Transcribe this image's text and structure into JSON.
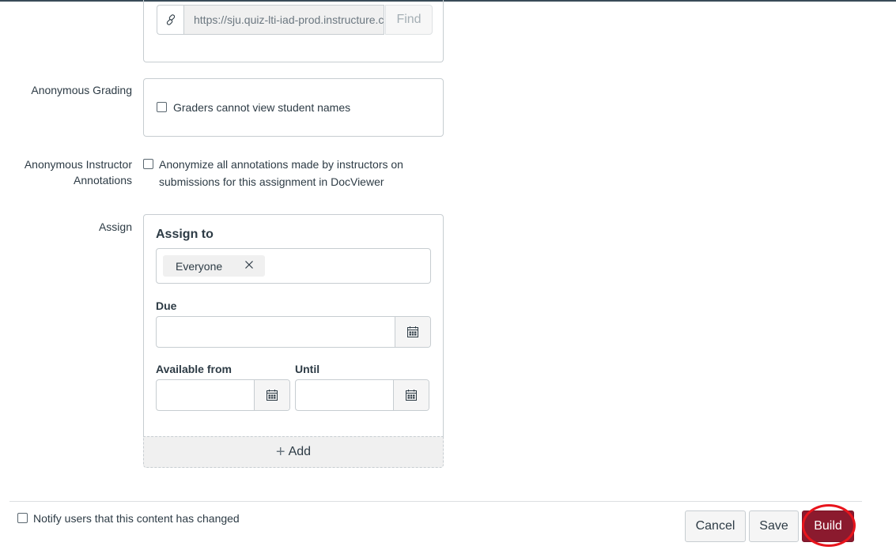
{
  "external_tool": {
    "url_value": "https://sju.quiz-lti-iad-prod.instructure.com",
    "find_label": "Find",
    "icon": "link-icon"
  },
  "anonymous_grading": {
    "label": "Anonymous Grading",
    "checkbox_label": "Graders cannot view student names",
    "checked": false
  },
  "anonymous_annotations": {
    "label_line1": "Anonymous Instructor",
    "label_line2": "Annotations",
    "checkbox_line1": "Anonymize all annotations made by instructors on",
    "checkbox_line2": "submissions for this assignment in DocViewer",
    "checked": false
  },
  "assign": {
    "label": "Assign",
    "assign_to_heading": "Assign to",
    "assignees": [
      {
        "label": "Everyone",
        "remove_icon": "close-icon"
      }
    ],
    "due_label": "Due",
    "due_value": "",
    "available_from_label": "Available from",
    "available_from_value": "",
    "until_label": "Until",
    "until_value": "",
    "calendar_icon": "calendar-icon",
    "add_label": "Add",
    "add_icon": "plus-icon"
  },
  "footer": {
    "notify_label": "Notify users that this content has changed",
    "notify_checked": false,
    "cancel_label": "Cancel",
    "save_label": "Save",
    "build_label": "Build"
  },
  "colors": {
    "primary": "#8b1a2e",
    "highlight": "#e8141c",
    "top_bar": "#394b58"
  }
}
